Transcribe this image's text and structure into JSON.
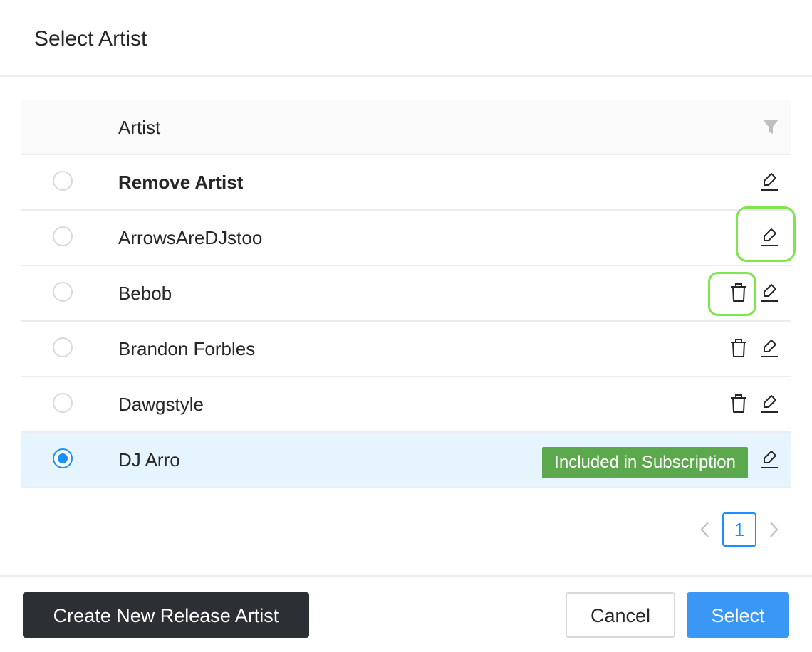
{
  "modal": {
    "title": "Select Artist"
  },
  "table": {
    "column_header": "Artist",
    "rows": [
      {
        "name": "Remove Artist",
        "selected": false,
        "bold": true
      },
      {
        "name": "ArrowsAreDJstoo",
        "selected": false
      },
      {
        "name": "Bebob",
        "selected": false
      },
      {
        "name": "Brandon Forbles",
        "selected": false
      },
      {
        "name": "Dawgstyle",
        "selected": false
      },
      {
        "name": "DJ Arro",
        "selected": true,
        "badge": "Included in Subscription"
      }
    ]
  },
  "pagination": {
    "current_page": "1"
  },
  "footer": {
    "create_label": "Create New Release Artist",
    "cancel_label": "Cancel",
    "select_label": "Select"
  },
  "colors": {
    "accent": "#1890ff",
    "badge": "#5ca84d",
    "create_button": "#2c2f33",
    "select_button": "#3b97f5",
    "highlight": "#7ee64a",
    "selected_row": "#e6f4fe"
  },
  "icons": {
    "filter": "filter-icon",
    "edit": "edit-icon",
    "delete": "delete-icon",
    "prev": "chevron-left-icon",
    "next": "chevron-right-icon"
  }
}
